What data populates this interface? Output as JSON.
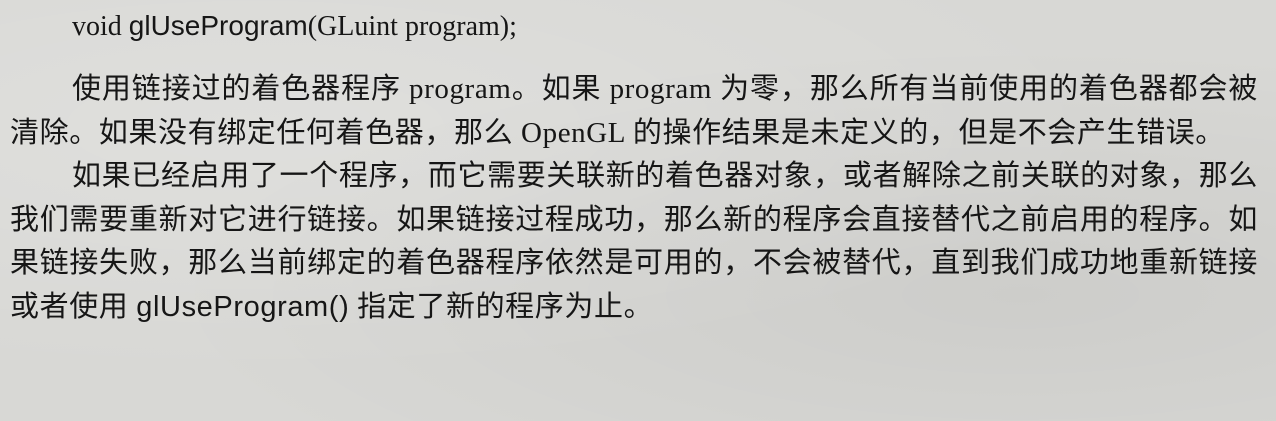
{
  "signature": {
    "return_type": "void",
    "function_name": "glUseProgram",
    "params": "(GLuint program);"
  },
  "paragraphs": [
    {
      "text": "使用链接过的着色器程序 program。如果 program 为零，那么所有当前使用的着色器都会被清除。如果没有绑定任何着色器，那么 OpenGL 的操作结果是未定义的，但是不会产生错误。"
    },
    {
      "text_before": "如果已经启用了一个程序，而它需要关联新的着色器对象，或者解除之前关联的对象，那么我们需要重新对它进行链接。如果链接过程成功，那么新的程序会直接替代之前启用的程序。如果链接失败，那么当前绑定的着色器程序依然是可用的，不会被替代，直到我们成功地重新链接或者使用 ",
      "code": "glUseProgram()",
      "text_after": " 指定了新的程序为止。"
    }
  ]
}
